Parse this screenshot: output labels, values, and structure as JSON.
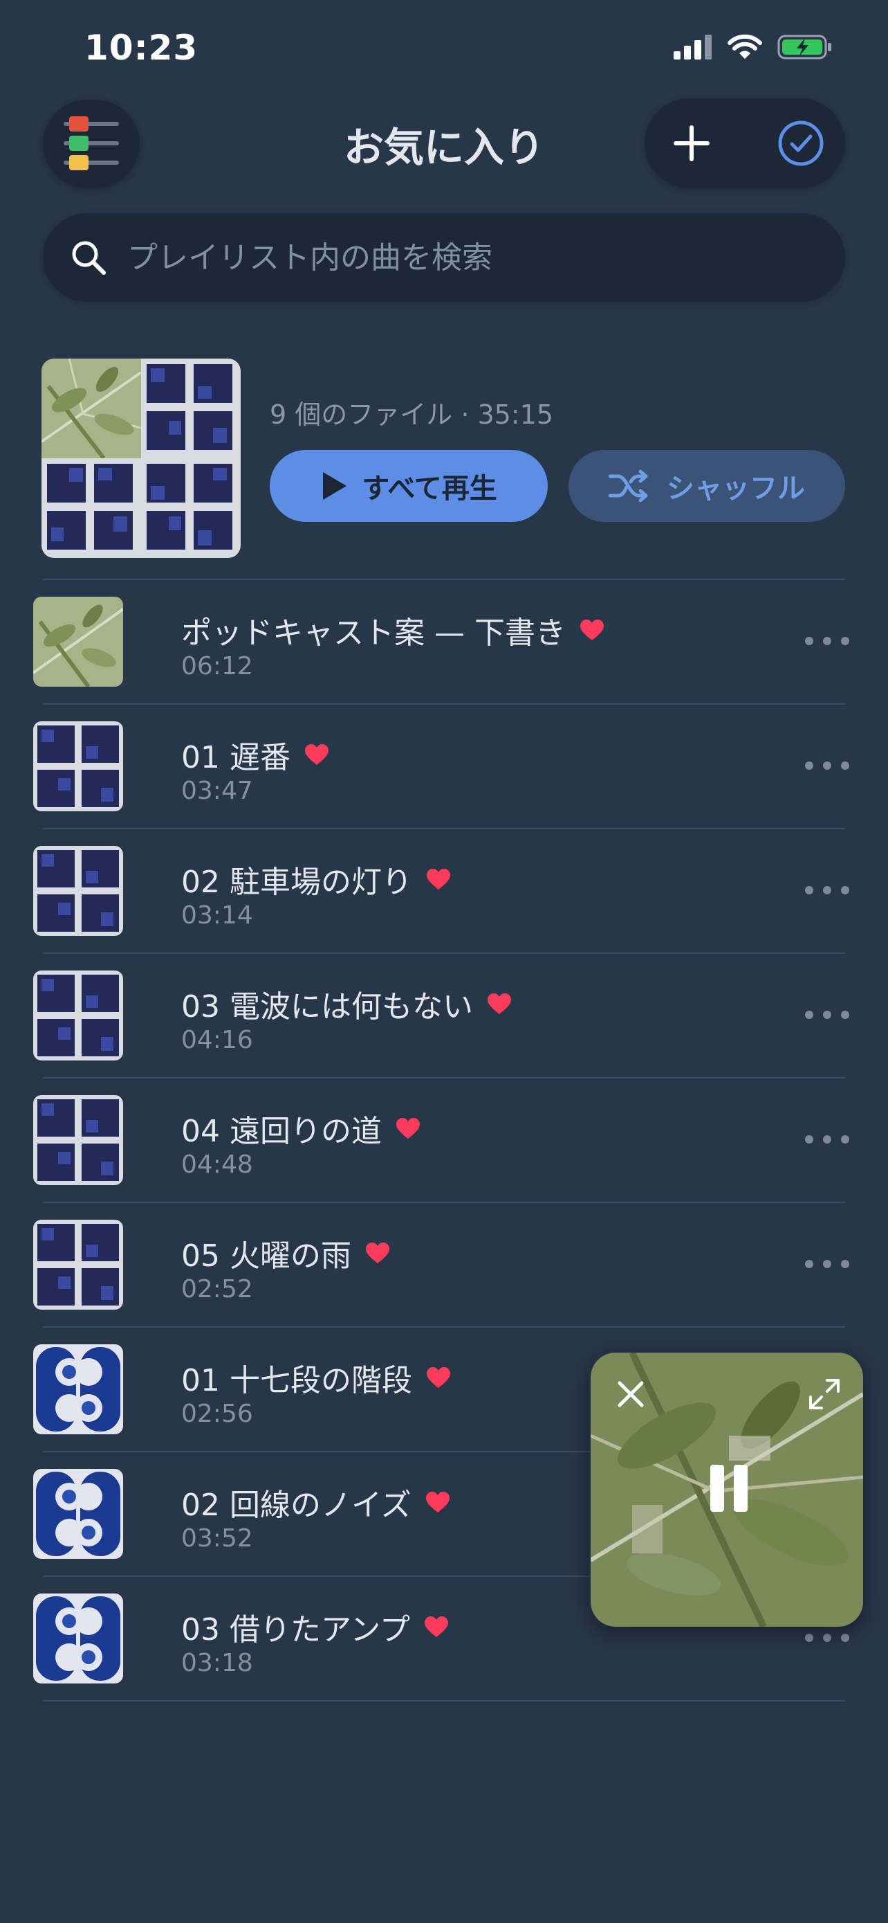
{
  "status_bar": {
    "time": "10:23"
  },
  "header": {
    "title": "お気に入り"
  },
  "search": {
    "placeholder": "プレイリスト内の曲を検索",
    "value": ""
  },
  "playlist": {
    "file_info": "9 個のファイル · 35:15",
    "play_all_label": "すべて再生",
    "shuffle_label": "シャッフル"
  },
  "tracks": [
    {
      "title": "ポッドキャスト案 — 下書き",
      "duration": "06:12",
      "favorite": true,
      "art": "leaf"
    },
    {
      "title": "01 遅番",
      "duration": "03:47",
      "favorite": true,
      "art": "building"
    },
    {
      "title": "02 駐車場の灯り",
      "duration": "03:14",
      "favorite": true,
      "art": "building"
    },
    {
      "title": "03 電波には何もない",
      "duration": "04:16",
      "favorite": true,
      "art": "building"
    },
    {
      "title": "04 遠回りの道",
      "duration": "04:48",
      "favorite": true,
      "art": "building"
    },
    {
      "title": "05 火曜の雨",
      "duration": "02:52",
      "favorite": true,
      "art": "building"
    },
    {
      "title": "01 十七段の階段",
      "duration": "02:56",
      "favorite": true,
      "art": "blue-pattern"
    },
    {
      "title": "02 回線のノイズ",
      "duration": "03:52",
      "favorite": true,
      "art": "blue-pattern"
    },
    {
      "title": "03 借りたアンプ",
      "duration": "03:18",
      "favorite": true,
      "art": "blue-pattern"
    }
  ],
  "mini_player": {
    "state": "playing",
    "art": "leaf"
  },
  "colors": {
    "background": "#28364a",
    "surface": "#1c2838",
    "accent": "#5d8de5",
    "heart": "#ff3b5c",
    "secondary_text": "#8390a1"
  }
}
